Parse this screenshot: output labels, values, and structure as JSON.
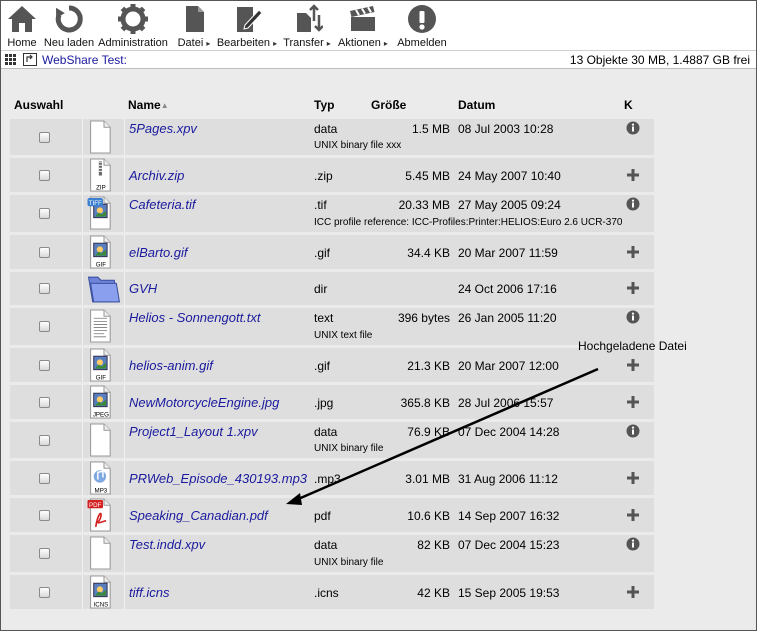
{
  "toolbar": {
    "home": "Home",
    "reload": "Neu laden",
    "admin": "Administration",
    "file": "Datei",
    "edit": "Bearbeiten",
    "transfer": "Transfer",
    "actions": "Aktionen",
    "logout": "Abmelden"
  },
  "pathbar": {
    "location": "WebShare Test:",
    "stats": "13 Objekte 30 MB, 1.4887 GB frei"
  },
  "columns": {
    "select": "Auswahl",
    "name": "Name",
    "type": "Typ",
    "size": "Größe",
    "date": "Datum",
    "k": "K"
  },
  "files": [
    {
      "name": "5Pages.xpv",
      "type": "data",
      "size": "1.5 MB",
      "date": "08 Jul 2003 10:28",
      "desc": "UNIX binary file xxx",
      "icon": "blank-document-icon",
      "action": "info-icon"
    },
    {
      "name": "Archiv.zip",
      "type": ".zip",
      "size": "5.45 MB",
      "date": "24 May 2007 10:40",
      "desc": "",
      "icon": "zip-file-icon",
      "action": "plus-icon"
    },
    {
      "name": "Cafeteria.tif",
      "type": ".tif",
      "size": "20.33 MB",
      "date": "27 May 2005 09:24",
      "desc": "ICC profile reference: ICC-Profiles:Printer:HELIOS:Euro 2.6 UCR-370",
      "icon": "tiff-file-icon",
      "action": "info-icon"
    },
    {
      "name": "elBarto.gif",
      "type": ".gif",
      "size": "34.4 KB",
      "date": "20 Mar 2007 11:59",
      "desc": "",
      "icon": "gif-file-icon",
      "action": "plus-icon"
    },
    {
      "name": "GVH",
      "type": "dir",
      "size": "",
      "date": "24 Oct 2006 17:16",
      "desc": "",
      "icon": "folder-icon",
      "action": "plus-icon"
    },
    {
      "name": "Helios - Sonnengott.txt",
      "type": "text",
      "size": "396 bytes",
      "date": "26 Jan 2005 11:20",
      "desc": "UNIX text file",
      "icon": "text-file-icon",
      "action": "info-icon"
    },
    {
      "name": "helios-anim.gif",
      "type": ".gif",
      "size": "21.3 KB",
      "date": "20 Mar 2007 12:00",
      "desc": "",
      "icon": "gif-file-icon",
      "action": "plus-icon"
    },
    {
      "name": "NewMotorcycleEngine.jpg",
      "type": ".jpg",
      "size": "365.8 KB",
      "date": "28 Jul 2006 15:57",
      "desc": "",
      "icon": "jpeg-file-icon",
      "action": "plus-icon"
    },
    {
      "name": "Project1_Layout 1.xpv",
      "type": "data",
      "size": "76.9 KB",
      "date": "07 Dec 2004 14:28",
      "desc": "UNIX binary file",
      "icon": "blank-document-icon",
      "action": "info-icon"
    },
    {
      "name": "PRWeb_Episode_430193.mp3",
      "type": ".mp3",
      "size": "3.01 MB",
      "date": "31 Aug 2006 11:12",
      "desc": "",
      "icon": "mp3-file-icon",
      "action": "plus-icon"
    },
    {
      "name": "Speaking_Canadian.pdf",
      "type": "pdf",
      "size": "10.6 KB",
      "date": "14 Sep 2007 16:32",
      "desc": "",
      "icon": "pdf-file-icon",
      "action": "plus-icon"
    },
    {
      "name": "Test.indd.xpv",
      "type": "data",
      "size": "82 KB",
      "date": "07 Dec 2004 15:23",
      "desc": "UNIX binary file",
      "icon": "blank-document-icon",
      "action": "info-icon"
    },
    {
      "name": "tiff.icns",
      "type": ".icns",
      "size": "42 KB",
      "date": "15 Sep 2005 19:53",
      "desc": "",
      "icon": "icns-file-icon",
      "action": "plus-icon"
    }
  ],
  "annotation": {
    "label": "Hochgeladene Datei"
  }
}
